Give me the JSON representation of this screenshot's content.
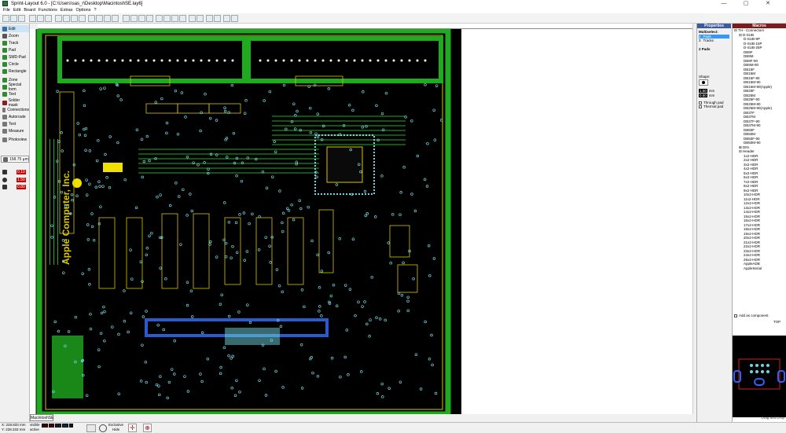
{
  "app": {
    "title": "Sprint-Layout 6.0 - [C:\\Users\\sas_r\\Desktop\\MacintoshSE.lay6]"
  },
  "window_controls": {
    "minimize": "—",
    "maximize": "▢",
    "close": "✕"
  },
  "menu": [
    "File",
    "Edit",
    "Board",
    "Functions",
    "Extras",
    "Options",
    "?"
  ],
  "tools": [
    {
      "label": "Edit",
      "icon": "pointer-icon",
      "color": "#3a6ea5"
    },
    {
      "label": "Zoom",
      "icon": "magnifier-icon",
      "color": "#555555"
    },
    {
      "label": "Track",
      "icon": "track-icon",
      "color": "#2e8b2e"
    },
    {
      "label": "Pad",
      "icon": "pad-icon",
      "color": "#2e8b2e"
    },
    {
      "label": "SMD-Pad",
      "icon": "smd-pad-icon",
      "color": "#2e8b2e"
    },
    {
      "label": "Circle",
      "icon": "circle-icon",
      "color": "#2e8b2e"
    },
    {
      "label": "Rectangle",
      "icon": "rectangle-icon",
      "color": "#2e8b2e"
    },
    {
      "label": "Zone",
      "icon": "zone-icon",
      "color": "#2e8b2e"
    },
    {
      "label": "Special form",
      "icon": "special-form-icon",
      "color": "#2e8b2e"
    },
    {
      "label": "Text",
      "icon": "text-icon",
      "color": "#2e8b2e"
    },
    {
      "label": "Solder mask",
      "icon": "solder-mask-icon",
      "color": "#8b2020"
    },
    {
      "label": "Connections",
      "icon": "connections-icon",
      "color": "#777777"
    },
    {
      "label": "Autoroute",
      "icon": "autoroute-icon",
      "color": "#777777"
    },
    {
      "label": "Test",
      "icon": "test-icon",
      "color": "#777777"
    },
    {
      "label": "Measure",
      "icon": "measure-icon",
      "color": "#777777"
    },
    {
      "label": "Photoview",
      "icon": "photoview-icon",
      "color": "#777777"
    }
  ],
  "grid": {
    "value": "158.75 µm"
  },
  "widths": [
    {
      "value": "0.10"
    },
    {
      "value": "1.50"
    },
    {
      "value": "0.80"
    }
  ],
  "properties": {
    "header": "Properties",
    "multiselect_label": "Multiselect:",
    "rows": [
      {
        "count": "2",
        "kind": "Pads"
      },
      {
        "count": "3",
        "kind": "Tracks"
      }
    ],
    "pads_title": "2 Pads",
    "shape_label": "Shape:",
    "hole_values": [
      "1.50",
      "0.80"
    ],
    "unit": "mm",
    "through_pad": "Through pad",
    "thermal_pad": "Thermal pad"
  },
  "macros": {
    "header": "Macros",
    "tree": [
      {
        "indent": 0,
        "text": "⊟ TH - Connectors"
      },
      {
        "indent": 1,
        "text": "⊟ D-SUB"
      },
      {
        "indent": 2,
        "text": "D-SUB-9P"
      },
      {
        "indent": 2,
        "text": "D-SUB-15P"
      },
      {
        "indent": 2,
        "text": "D-SUB-25P"
      },
      {
        "indent": 2,
        "text": "DB9F"
      },
      {
        "indent": 2,
        "text": "DB9M"
      },
      {
        "indent": 2,
        "text": "DB9F-90"
      },
      {
        "indent": 2,
        "text": "DB9M-90"
      },
      {
        "indent": 2,
        "text": "DB15F"
      },
      {
        "indent": 2,
        "text": "DB15M"
      },
      {
        "indent": 2,
        "text": "DB15F-90"
      },
      {
        "indent": 2,
        "text": "DB15M-90"
      },
      {
        "indent": 2,
        "text": "DB15M-90(Apple)"
      },
      {
        "indent": 2,
        "text": "DB25F"
      },
      {
        "indent": 2,
        "text": "DB25M"
      },
      {
        "indent": 2,
        "text": "DB25F-90"
      },
      {
        "indent": 2,
        "text": "DB25M-90"
      },
      {
        "indent": 2,
        "text": "DB25M-90(Apple)"
      },
      {
        "indent": 2,
        "text": "DB37F"
      },
      {
        "indent": 2,
        "text": "DB37M"
      },
      {
        "indent": 2,
        "text": "DB37F-90"
      },
      {
        "indent": 2,
        "text": "DB37M-90"
      },
      {
        "indent": 2,
        "text": "DB50F"
      },
      {
        "indent": 2,
        "text": "DB50M"
      },
      {
        "indent": 2,
        "text": "DB50F-90"
      },
      {
        "indent": 2,
        "text": "DB50M-90"
      },
      {
        "indent": 1,
        "text": "⊞ DIN"
      },
      {
        "indent": 1,
        "text": "⊟ Header"
      },
      {
        "indent": 2,
        "text": "1x2-HDR"
      },
      {
        "indent": 2,
        "text": "2x2-HDR"
      },
      {
        "indent": 2,
        "text": "3x2-HDR"
      },
      {
        "indent": 2,
        "text": "4x2-HDR"
      },
      {
        "indent": 2,
        "text": "5x2-HDR"
      },
      {
        "indent": 2,
        "text": "6x2-HDR"
      },
      {
        "indent": 2,
        "text": "7x2-HDR"
      },
      {
        "indent": 2,
        "text": "8x2-HDR"
      },
      {
        "indent": 2,
        "text": "9x2-HDR"
      },
      {
        "indent": 2,
        "text": "10x2-HDR"
      },
      {
        "indent": 2,
        "text": "11x2-HDR"
      },
      {
        "indent": 2,
        "text": "12x2-HDR"
      },
      {
        "indent": 2,
        "text": "13x2-HDR"
      },
      {
        "indent": 2,
        "text": "14x2-HDR"
      },
      {
        "indent": 2,
        "text": "15x2-HDR"
      },
      {
        "indent": 2,
        "text": "16x2-HDR"
      },
      {
        "indent": 2,
        "text": "17x2-HDR"
      },
      {
        "indent": 2,
        "text": "18x2-HDR"
      },
      {
        "indent": 2,
        "text": "19x2-HDR"
      },
      {
        "indent": 2,
        "text": "20x2-HDR"
      },
      {
        "indent": 2,
        "text": "21x2-HDR"
      },
      {
        "indent": 2,
        "text": "22x2-HDR"
      },
      {
        "indent": 2,
        "text": "23x2-HDR"
      },
      {
        "indent": 2,
        "text": "24x2-HDR"
      },
      {
        "indent": 2,
        "text": "25x2-HDR"
      },
      {
        "indent": 2,
        "text": "AppleADB"
      },
      {
        "indent": 2,
        "text": "AppleSerial"
      }
    ],
    "add_as_component": "Add as component",
    "top_label": "TOP",
    "footer": "Drag and Drop"
  },
  "board": {
    "tab_label": "MacintoshSE",
    "silkscreen_text": "Apple Computer, Inc.",
    "colors": {
      "background": "#000000",
      "copper_top": "#1faa1f",
      "silkscreen": "#d8c600",
      "copper_bottom": "#2a5ad0",
      "pads": "#6fd5e0",
      "outline": "#d05010"
    }
  },
  "status": {
    "x_coord": "X: 228.833 mm",
    "y_coord": "Y: 228.333 mm",
    "visible": "visible",
    "active": "active",
    "layers": [
      "C1",
      "S1",
      "C2",
      "S2",
      "O"
    ],
    "exclusive": "Exclusive",
    "hide": "Hide"
  }
}
